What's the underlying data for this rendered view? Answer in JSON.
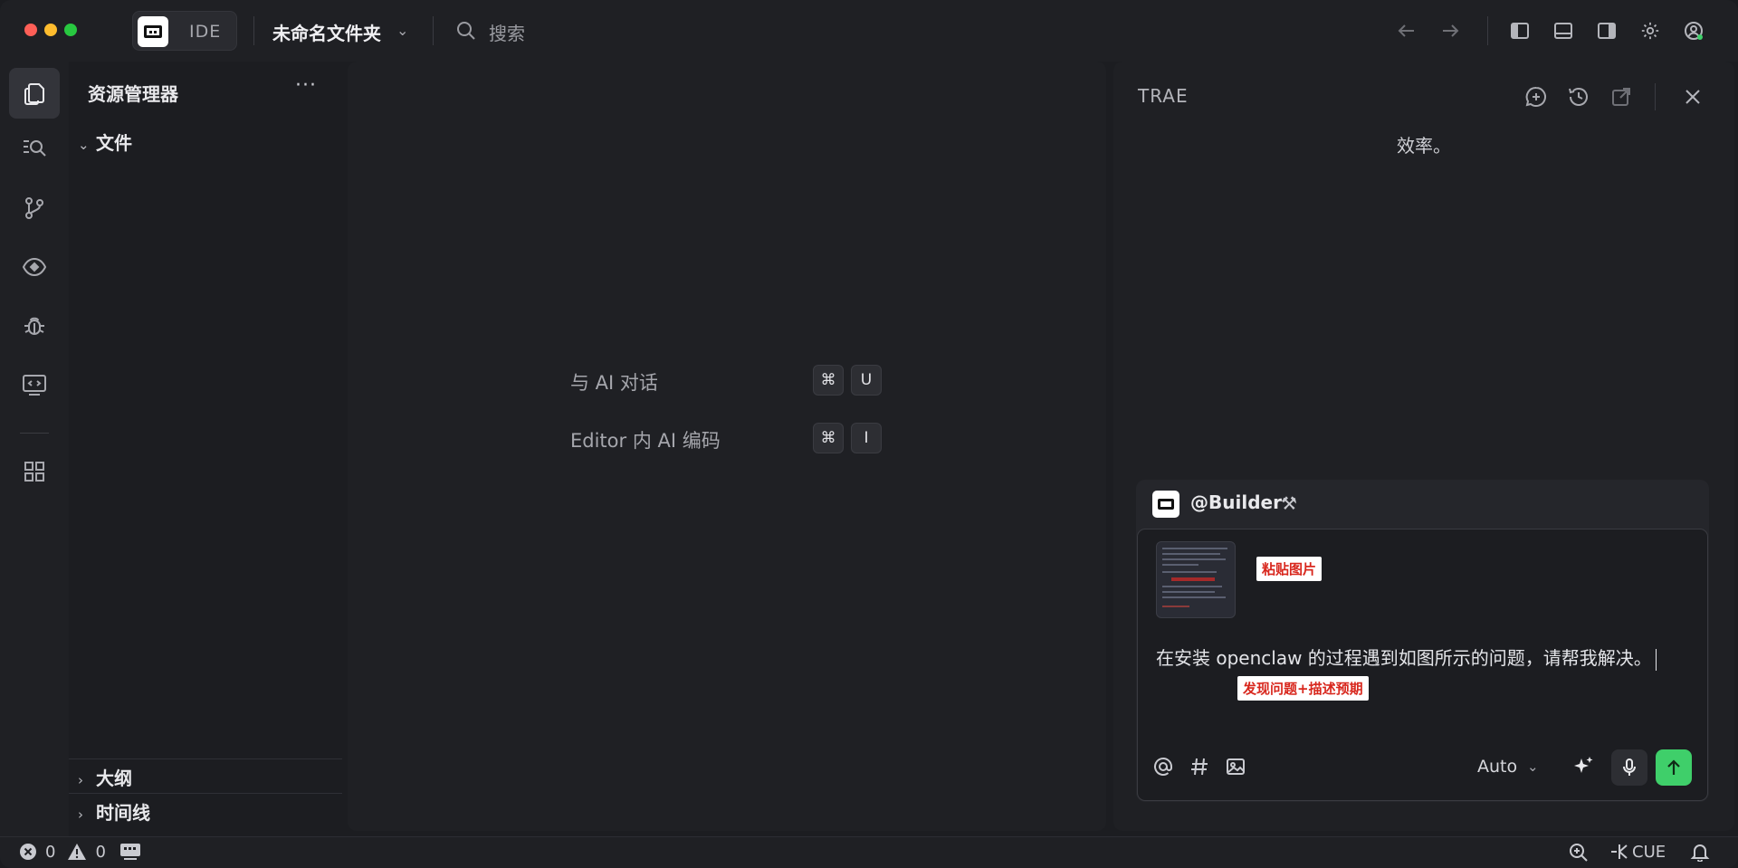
{
  "window": {
    "app_badge": "IDE",
    "folder_name": "未命名文件夹",
    "search_label": "搜索"
  },
  "activity_bar": {
    "items": [
      "explorer-icon",
      "search-icon",
      "source-control-icon",
      "preview-icon",
      "debug-icon",
      "remote-icon",
      "extensions-icon"
    ]
  },
  "explorer": {
    "title": "资源管理器",
    "more": "···",
    "files_section": "文件",
    "outline_section": "大纲",
    "timeline_section": "时间线"
  },
  "editor": {
    "hints": [
      {
        "label": "与 AI 对话",
        "keys": [
          "⌘",
          "U"
        ]
      },
      {
        "label": "Editor 内 AI 编码",
        "keys": [
          "⌘",
          "I"
        ]
      }
    ]
  },
  "ai_panel": {
    "title": "TRAE",
    "previous_text": "效率。",
    "agent_name": "@Builder",
    "annotation_image": "粘贴图片",
    "message": "在安装 openclaw 的过程遇到如图所示的问题，请帮我解决。",
    "annotation_message": "发现问题+描述预期",
    "model_select": "Auto"
  },
  "status_bar": {
    "errors": "0",
    "warnings": "0",
    "cue_label": "CUE"
  },
  "colors": {
    "accent_send": "#3fcf6a",
    "annotation_red": "#d8271d"
  }
}
